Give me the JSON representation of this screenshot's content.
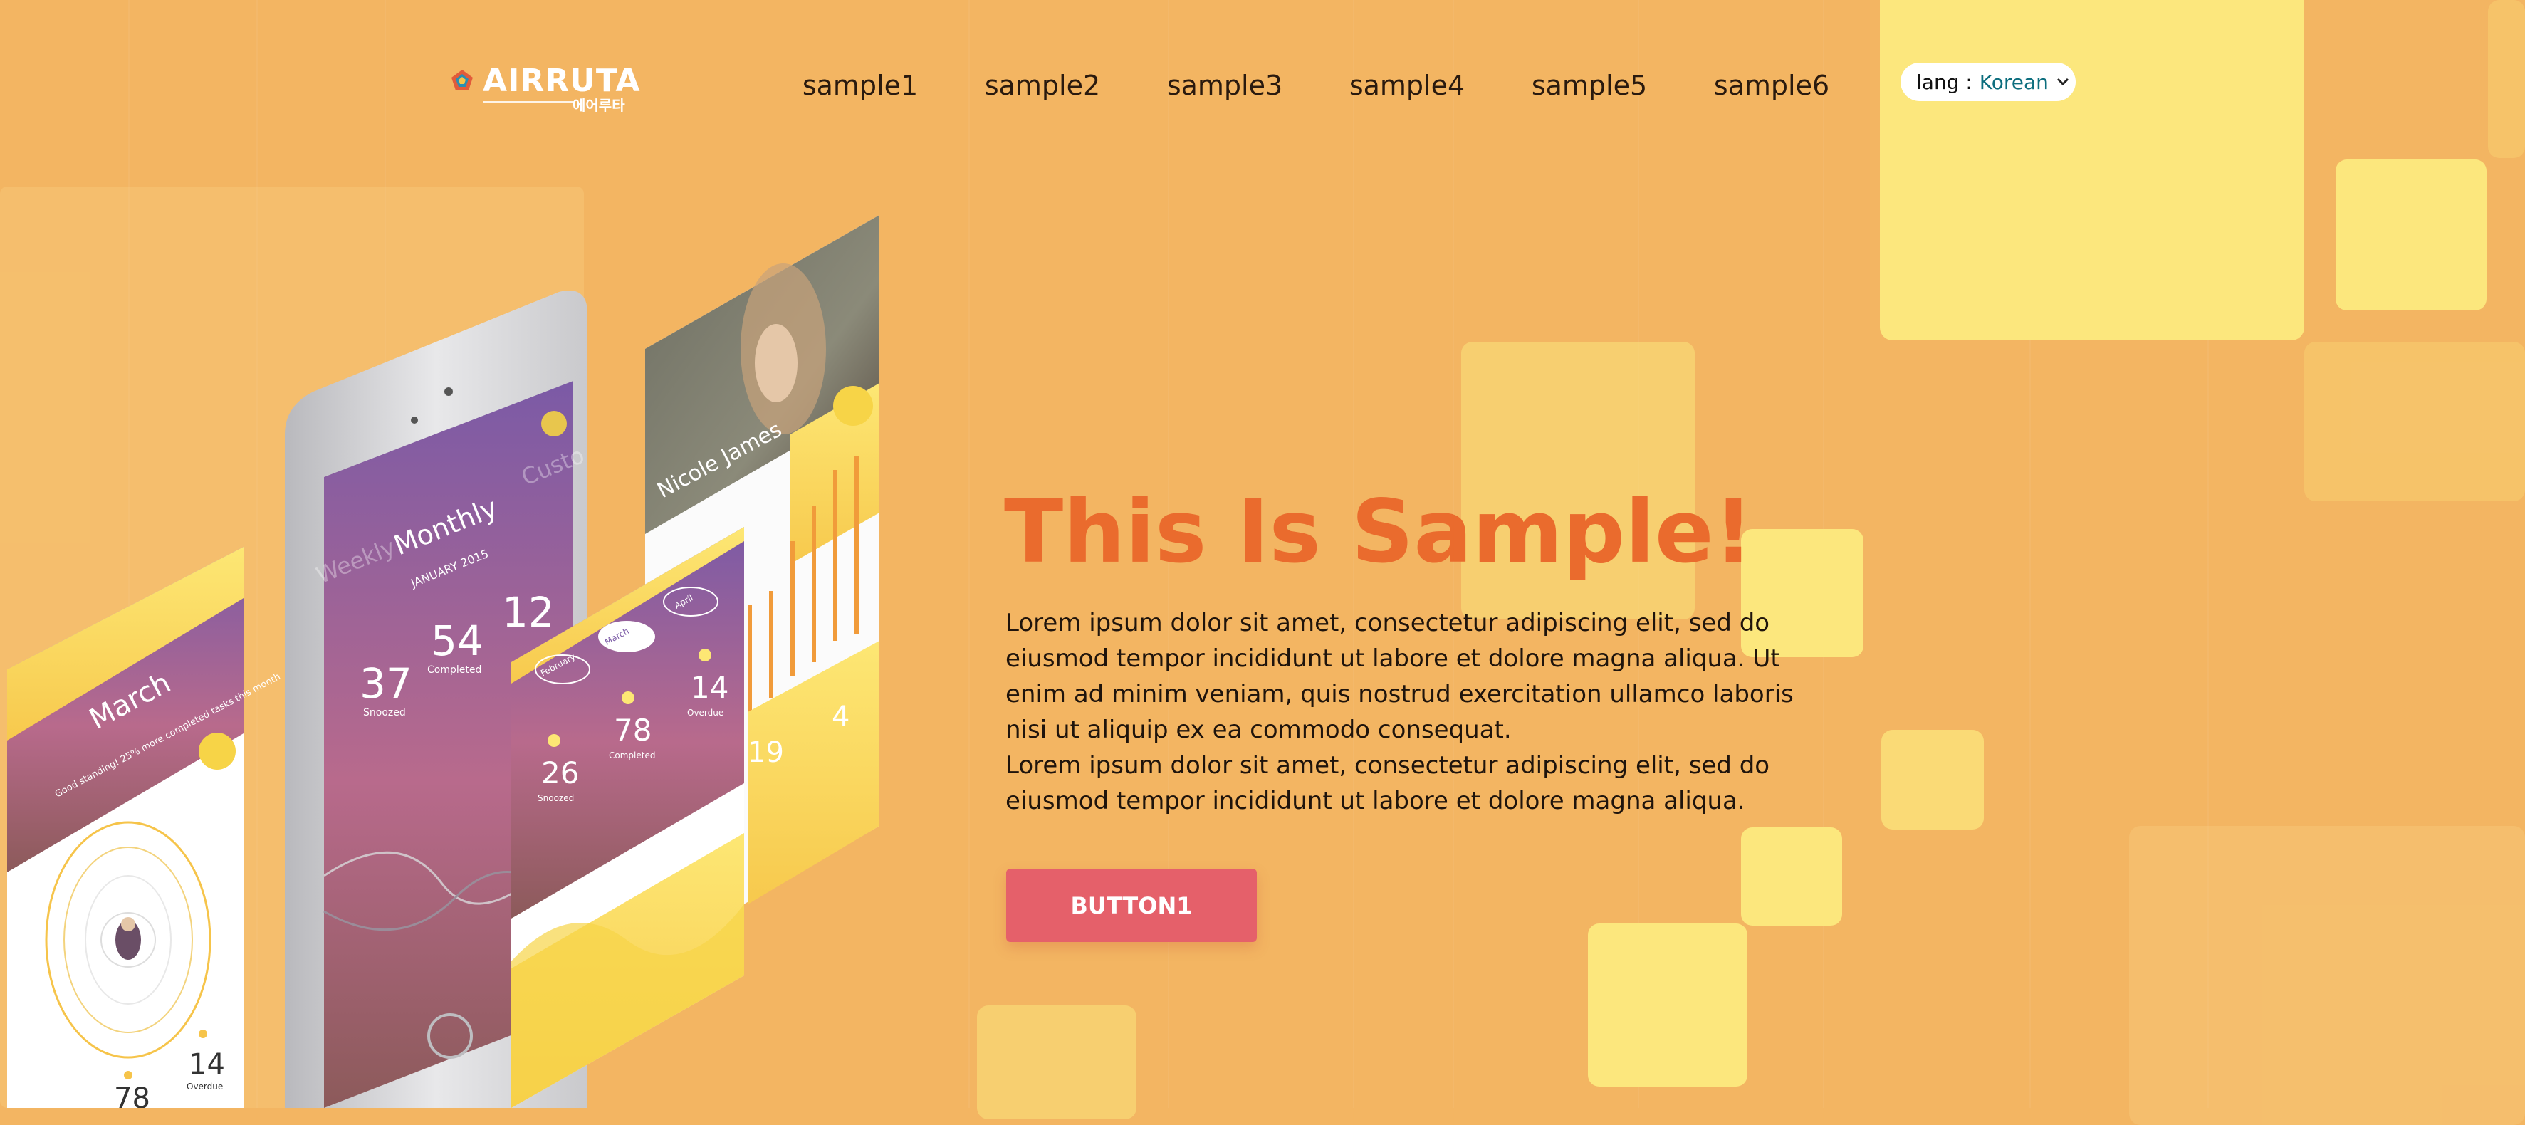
{
  "logo": {
    "name": "AIRRUTA",
    "sub": "에어루타"
  },
  "nav": {
    "items": [
      "sample1",
      "sample2",
      "sample3",
      "sample4",
      "sample5",
      "sample6"
    ]
  },
  "lang": {
    "label": "lang :",
    "value": "Korean"
  },
  "hero": {
    "title": "This Is Sample!",
    "lines": [
      "Lorem ipsum dolor sit amet, consectetur adipiscing elit, sed do eiusmod tempor incididunt ut labore et dolore magna aliqua. Ut enim ad minim veniam, quis nostrud exercitation ullamco laboris nisi ut aliquip ex ea commodo consequat.",
      "Lorem ipsum dolor sit amet, consectetur adipiscing elit, sed do eiusmod tempor incididunt ut labore et dolore magna aliqua."
    ],
    "button": "BUTTON1"
  },
  "mockup": {
    "phone": {
      "title": "Monthly",
      "date": "JANUARY 2015",
      "stats": [
        {
          "value": "37",
          "label": "Snoozed"
        },
        {
          "value": "54",
          "label": "Completed"
        },
        {
          "value": "12",
          "label": ""
        }
      ],
      "ghost_left": "Weekly",
      "ghost_right": "Custo"
    },
    "card_left": {
      "title": "March",
      "subtitle": "Good standing! 25% more completed tasks this month",
      "stats": [
        {
          "value": "78",
          "label": ""
        },
        {
          "value": "14",
          "label": "Overdue"
        }
      ]
    },
    "card_mid": {
      "tabs": [
        "February",
        "March",
        "April"
      ],
      "stats": [
        {
          "value": "26",
          "label": "Snoozed"
        },
        {
          "value": "78",
          "label": "Completed"
        },
        {
          "value": "14",
          "label": "Overdue"
        }
      ]
    },
    "card_right": {
      "name": "Nicole James",
      "stats": [
        {
          "value": "19",
          "label": ""
        },
        {
          "value": "4",
          "label": ""
        }
      ]
    }
  },
  "colors": {
    "background": "#f3b562",
    "title": "#ea6b2d",
    "button": "#e5606a",
    "square": "#fce77d",
    "lang_value": "#0d6e7e"
  }
}
